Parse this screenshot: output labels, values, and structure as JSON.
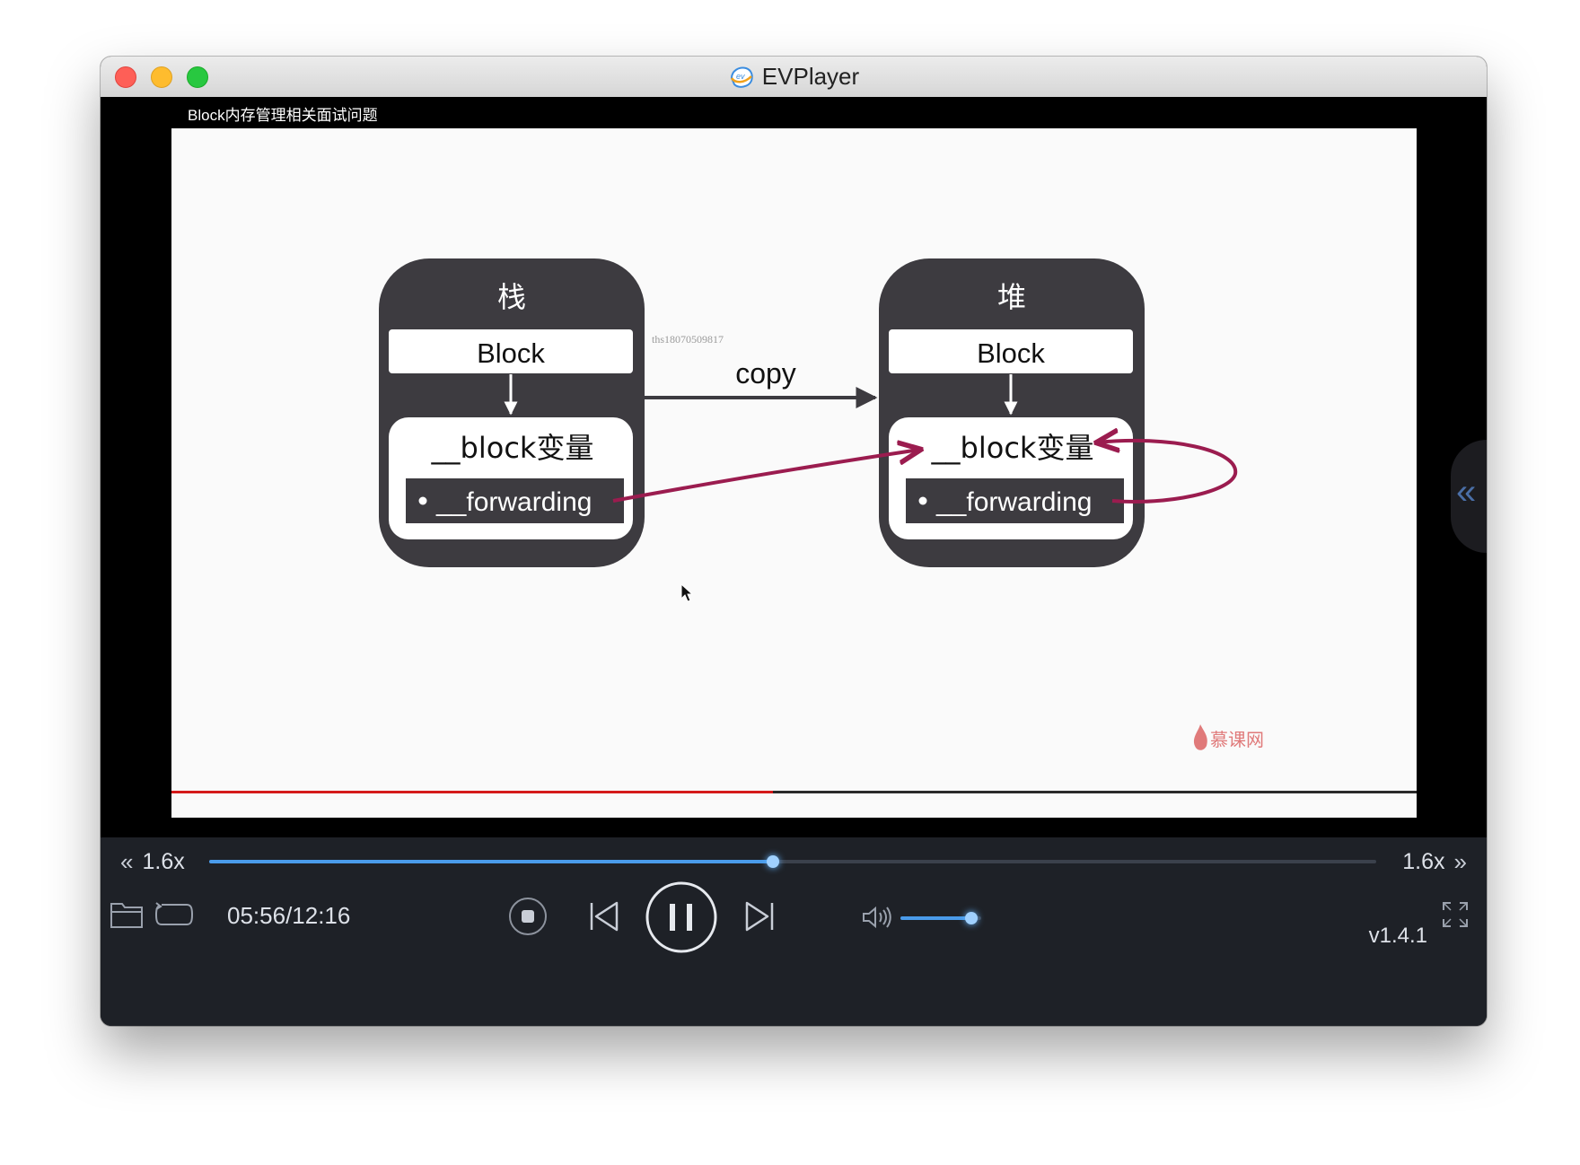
{
  "window": {
    "title": "EVPlayer"
  },
  "video": {
    "caption": "Block内存管理相关面试问题",
    "progress_fraction": 0.483,
    "slide": {
      "left_box_title": "栈",
      "right_box_title": "堆",
      "block_label": "Block",
      "var_label": "__block变量",
      "forwarding_label": "__forwarding",
      "arrow_label": "copy",
      "watermark_text": "ths18070509817",
      "logo_text": "慕课网"
    }
  },
  "controls": {
    "speed_left": "1.6x",
    "speed_right": "1.6x",
    "seek_fraction": 0.483,
    "time": "05:56/12:16",
    "volume_fraction": 0.88,
    "version": "v1.4.1"
  },
  "colors": {
    "accent": "#4a9bea",
    "video_progress": "#d41a1a",
    "diagram_box": "#3d3b40",
    "diagram_arrow": "#9b1c4f"
  },
  "icons": [
    "evplayer-app-icon",
    "double-chevron-left-icon",
    "double-chevron-right-icon",
    "folder-icon",
    "loop-icon",
    "stop-icon",
    "previous-track-icon",
    "pause-icon",
    "next-track-icon",
    "volume-icon",
    "fullscreen-icon",
    "collapse-panel-icon",
    "mouse-cursor-icon"
  ]
}
